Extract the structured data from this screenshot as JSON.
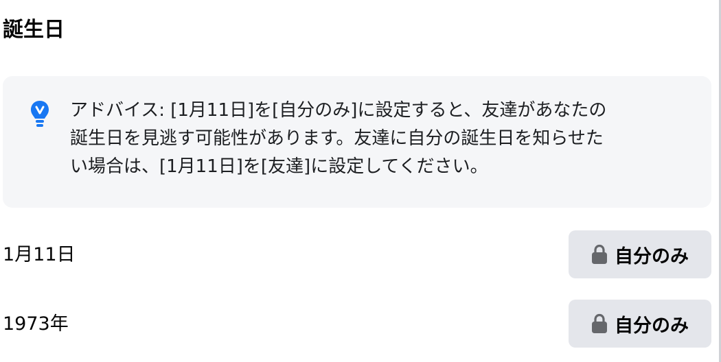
{
  "section": {
    "title": "誕生日"
  },
  "tip": {
    "icon": "lightbulb-icon",
    "icon_color": "#1877f2",
    "lines": [
      "アドバイス: [1月11日]を[自分のみ]に設定すると、友達があなたの",
      "誕生日を見逃す可能性があります。友達に自分の誕生日を知らせた",
      "い場合は、[1月11日]を[友達]に設定してください。"
    ]
  },
  "rows": [
    {
      "label": "1月11日",
      "privacy_icon": "lock-icon",
      "privacy_label": "自分のみ"
    },
    {
      "label": "1973年",
      "privacy_icon": "lock-icon",
      "privacy_label": "自分のみ"
    }
  ],
  "colors": {
    "tip_background": "#f5f6f8",
    "button_background": "#e4e6eb",
    "lock_icon": "#65676b"
  }
}
